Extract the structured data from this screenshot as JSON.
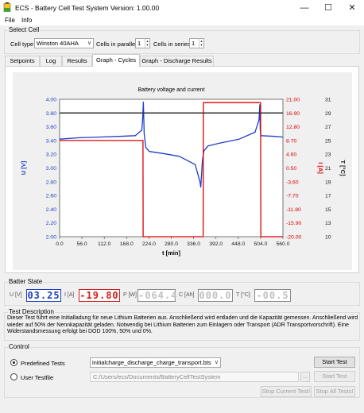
{
  "window": {
    "title": "ECS - Battery Cell Test System Version: 1.00.00",
    "minimize": "—",
    "maximize": "☐",
    "close": "✕"
  },
  "menu": {
    "file": "File",
    "info": "Info"
  },
  "select_cell": {
    "group_title": "Select Cell",
    "cell_type_label": "Cell type",
    "cell_type_value": "Winston 40AHA",
    "parallel_label": "Cells in parallel",
    "parallel_value": "1",
    "series_label": "Cells in series",
    "series_value": "1"
  },
  "tabs": [
    "Setpoints",
    "Log",
    "Results",
    "Graph - Cycles",
    "Graph - Discharge Results"
  ],
  "active_tab": "Graph - Cycles",
  "chart_data": {
    "type": "line",
    "title": "Battery voltage and current",
    "xlabel": "t [min]",
    "ylabel_left": "U [V]",
    "ylabel_right1": "I [A]",
    "ylabel_right2": "T [°C]",
    "xlim": [
      0,
      560
    ],
    "x_ticks": [
      "0.0",
      "56.0",
      "112.0",
      "168.0",
      "224.0",
      "280.0",
      "336.0",
      "392.0",
      "448.0",
      "504.0",
      "560.0"
    ],
    "ylim_left": [
      2.0,
      4.0
    ],
    "left_ticks": [
      "2.00",
      "2.20",
      "2.40",
      "2.60",
      "2.80",
      "3.00",
      "3.20",
      "3.40",
      "3.60",
      "3.80",
      "4.00"
    ],
    "ylim_right1": [
      -20.0,
      21.0
    ],
    "right1_ticks": [
      "-20.00",
      "-15.90",
      "-11.80",
      "-7.70",
      "-3.60",
      "0.50",
      "4.60",
      "8.70",
      "12.80",
      "16.90",
      "21.00"
    ],
    "ylim_right2": [
      10,
      31
    ],
    "right2_ticks": [
      "10",
      "13",
      "15",
      "17",
      "19",
      "21",
      "23",
      "25",
      "27",
      "29",
      "31"
    ],
    "series": [
      {
        "name": "U [V]",
        "color": "#1c3ec9",
        "x": [
          0,
          50,
          100,
          150,
          190,
          206,
          208,
          210,
          212,
          216,
          225,
          260,
          300,
          340,
          352,
          354,
          356,
          358,
          362,
          372,
          400,
          450,
          490,
          500,
          502,
          503,
          505,
          540,
          560
        ],
        "y": [
          3.42,
          3.44,
          3.45,
          3.46,
          3.47,
          3.55,
          3.7,
          3.96,
          3.5,
          3.3,
          3.24,
          3.21,
          3.17,
          3.05,
          2.8,
          2.72,
          2.9,
          3.1,
          3.25,
          3.32,
          3.36,
          3.42,
          3.52,
          3.7,
          3.92,
          3.56,
          3.47,
          3.46,
          3.45
        ]
      },
      {
        "name": "I [A]",
        "color": "#e00000",
        "x": [
          0,
          209,
          209.5,
          360,
          360.5,
          504,
          504.5,
          560
        ],
        "y": [
          8.7,
          8.7,
          -20.0,
          -20.0,
          20.0,
          20.0,
          -20.0,
          -20.0
        ]
      },
      {
        "name": "T [°C]",
        "color": "#333333",
        "x": [
          0,
          560
        ],
        "y": [
          28.9,
          28.9
        ]
      }
    ]
  },
  "batter_state": {
    "group_title": "Batter State",
    "u_label": "U [V]",
    "u_value": "03.25",
    "i_label": "I [A]",
    "i_value": "-19.80",
    "p_label": "P [W]",
    "p_value": "-064.4",
    "c_label": "C [Ah]",
    "c_value": "000.0",
    "t_label": "T [°C]",
    "t_value": "-00.5"
  },
  "test_description": {
    "group_title": "Test Description",
    "text": "Dieser Test führt eine Initialladung für neue Lithium Batterien aus. Anschließend wird entladen und die Kapazität gemessen. Anschließend wird wieder auf 50% der Nennkapazität geladen. Notwendig bei Lithium Batterien zum Einlagern oder Transport (ADR Transportvorschrift). Eine Widerstandsmessung erfolgt bei DOD 100%, 50% und 0%."
  },
  "control": {
    "group_title": "Control",
    "predefined_label": "Predefined Tests",
    "predefined_value": "initialcharge_discharge_charge_transport.bts",
    "user_label": "User Testfile",
    "user_path": "C:/Users/ecs/Documents/BatteryCellTestSystem",
    "browse": "...",
    "start_test": "Start Test",
    "start_test_2": "Start Test",
    "stop_current": "Stop Current Test!",
    "stop_all": "Stop All Tests!"
  },
  "icons": {
    "app": "battery-app-icon",
    "dropdown": "chevron-down-icon"
  }
}
